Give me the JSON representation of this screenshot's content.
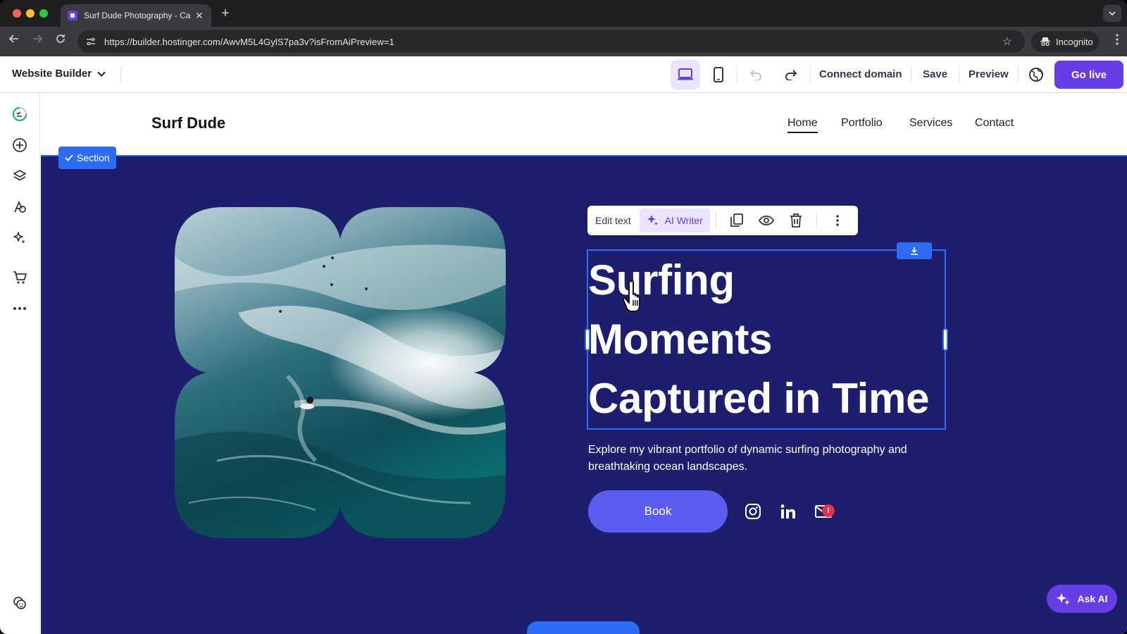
{
  "browser": {
    "tab_title": "Surf Dude Photography - Cap",
    "new_tab": "+",
    "url": "https://builder.hostinger.com/AwvM5L4GylS7pa3v?isFromAiPreview=1",
    "profile": "Incognito"
  },
  "builder": {
    "brand": "Website Builder",
    "connect_domain": "Connect domain",
    "save": "Save",
    "preview": "Preview",
    "go_live": "Go live",
    "ask_ai": "Ask AI",
    "accent_color": "#673de6",
    "selection_color": "#2f6cf5"
  },
  "sidebar": {
    "items": [
      {
        "icon": "checklist-icon"
      },
      {
        "icon": "add-element-icon"
      },
      {
        "icon": "layers-icon"
      },
      {
        "icon": "styles-icon"
      },
      {
        "icon": "ai-tools-icon"
      },
      {
        "icon": "store-icon"
      },
      {
        "icon": "more-icon"
      },
      {
        "icon": "help-icon"
      }
    ]
  },
  "site": {
    "logo": "Surf Dude",
    "nav": [
      "Home",
      "Portfolio",
      "Services",
      "Contact"
    ],
    "active_nav": "Home",
    "section_badge": "Section",
    "hero_bg": "#1d1f6e",
    "title_lines": [
      "Surfing",
      "Moments",
      "Captured in Time"
    ],
    "subtitle": "Explore my vibrant portfolio of dynamic surfing photography and breathtaking ocean landscapes.",
    "book": "Book",
    "notification": "!"
  },
  "text_toolbar": {
    "edit_text": "Edit text",
    "ai_writer": "AI Writer"
  }
}
